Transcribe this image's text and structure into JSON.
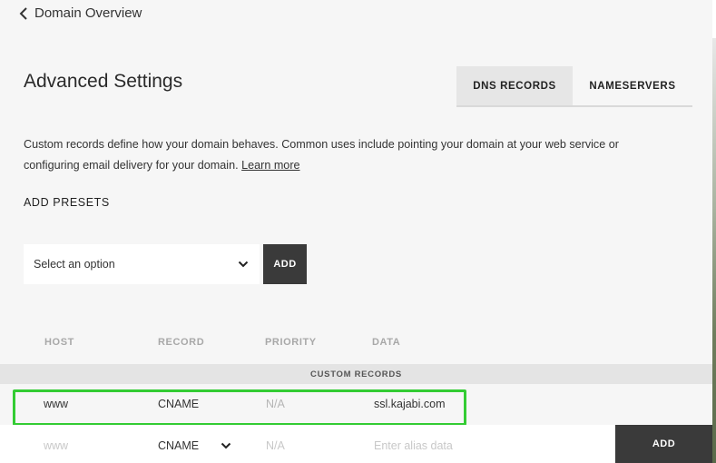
{
  "nav": {
    "back_label": "Domain Overview"
  },
  "header": {
    "title": "Advanced Settings"
  },
  "tabs": [
    {
      "label": "DNS RECORDS",
      "active": true
    },
    {
      "label": "NAMESERVERS",
      "active": false
    }
  ],
  "description": {
    "text": "Custom records define how your domain behaves. Common uses include pointing your domain at your web service or configuring email delivery for your domain.",
    "link": "Learn more"
  },
  "presets": {
    "heading": "ADD PRESETS",
    "select_value": "Select an option",
    "add_label": "ADD"
  },
  "table": {
    "columns": [
      "HOST",
      "RECORD",
      "PRIORITY",
      "DATA"
    ],
    "section_label": "CUSTOM RECORDS",
    "rows": [
      {
        "host": "www",
        "record": "CNAME",
        "priority": "N/A",
        "data": "ssl.kajabi.com"
      }
    ],
    "new_row": {
      "host_placeholder": "www",
      "record_value": "CNAME",
      "priority_placeholder": "N/A",
      "data_placeholder": "Enter alias data",
      "add_label": "ADD"
    }
  },
  "colors": {
    "highlight": "#33cc33",
    "button_bg": "#3a3a3a"
  },
  "icons": {
    "back": "chevron-left-icon",
    "dropdown": "chevron-down-icon"
  }
}
